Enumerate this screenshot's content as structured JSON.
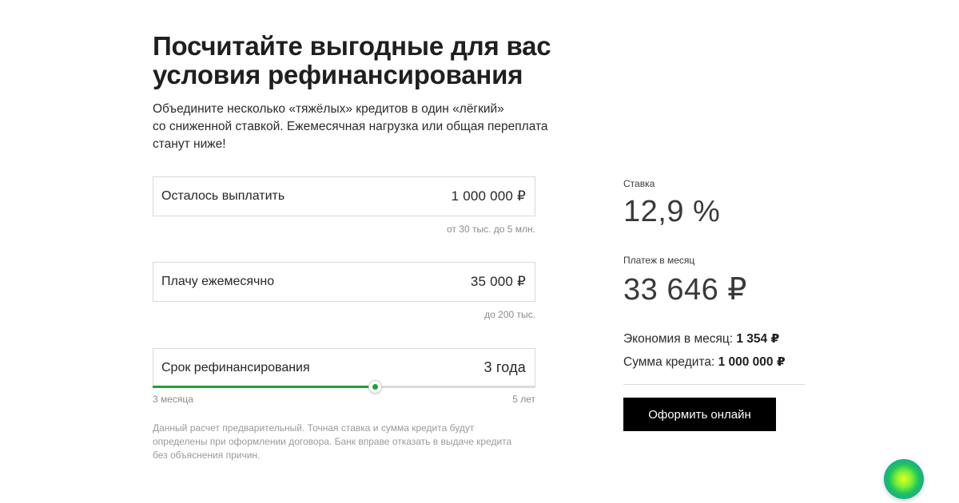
{
  "header": {
    "title_lines": [
      "Посчитайте выгодные для вас",
      "условия рефинансирования"
    ],
    "subtitle_lines": [
      "Объедините несколько «тяжёлых» кредитов в один «лёгкий»",
      "со сниженной ставкой. Ежемесячная нагрузка или общая переплата",
      "станут ниже!"
    ]
  },
  "form": {
    "remaining": {
      "label": "Осталось выплатить",
      "value": "1 000 000 ₽",
      "hint": "от 30 тыс. до 5 млн."
    },
    "monthly": {
      "label": "Плачу ежемесячно",
      "value": "35 000 ₽",
      "hint": "до 200 тыс."
    },
    "term": {
      "label": "Срок рефинансирования",
      "value": "3 года",
      "min_label": "3 месяца",
      "max_label": "5 лет",
      "slider_fraction": 0.58
    },
    "disclaimer_lines": [
      "Данный расчет предварительный. Точная ставка и сумма кредита будут",
      "определены при оформлении договора. Банк вправе отказать в выдаче кредита",
      "без объяснения причин."
    ]
  },
  "results": {
    "rate_label": "Ставка",
    "rate_value": "12,9 %",
    "payment_label": "Платеж в месяц",
    "payment_value": "33 646 ₽",
    "savings_label": "Экономия в месяц:",
    "savings_value": "1 354 ₽",
    "loan_label": "Сумма кредита:",
    "loan_value": "1 000 000 ₽",
    "cta_label": "Оформить онлайн"
  },
  "colors": {
    "accent_green": "#21a038",
    "cta_bg": "#000000"
  },
  "icons": {
    "assistant": "assistant-orb-icon"
  }
}
